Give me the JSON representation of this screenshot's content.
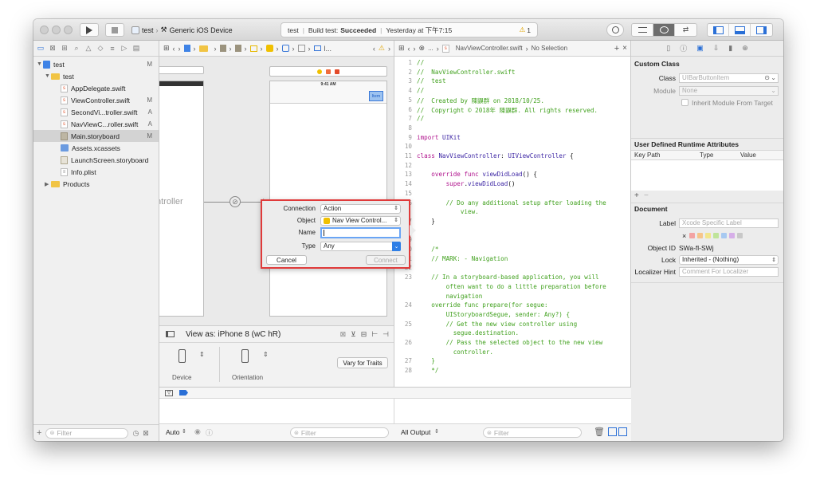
{
  "toolbar": {
    "scheme_target": "test",
    "device": "Generic iOS Device",
    "activity_target": "test",
    "activity_build_label": "Build test:",
    "activity_status": "Succeeded",
    "activity_time": "Yesterday at 下午7:15",
    "warning_count": "1"
  },
  "navigator": {
    "items": [
      {
        "label": "test",
        "status": "M",
        "kind": "project"
      },
      {
        "label": "test",
        "status": "",
        "kind": "folder"
      },
      {
        "label": "AppDelegate.swift",
        "status": "",
        "kind": "file"
      },
      {
        "label": "ViewController.swift",
        "status": "M",
        "kind": "file"
      },
      {
        "label": "SecondVi...troller.swift",
        "status": "A",
        "kind": "file"
      },
      {
        "label": "NavViewC...roller.swift",
        "status": "A",
        "kind": "file"
      },
      {
        "label": "Main.storyboard",
        "status": "M",
        "kind": "storyboard"
      },
      {
        "label": "Assets.xcassets",
        "status": "",
        "kind": "assets"
      },
      {
        "label": "LaunchScreen.storyboard",
        "status": "",
        "kind": "storyboard"
      },
      {
        "label": "Info.plist",
        "status": "",
        "kind": "file"
      },
      {
        "label": "Products",
        "status": "",
        "kind": "folder"
      }
    ],
    "filter_placeholder": "Filter"
  },
  "ib": {
    "jump_truncated": "l...",
    "controller_text": "ntroller",
    "status_time": "9:41 AM",
    "nav_item": "Item",
    "view_as": "View as: iPhone 8 (wC hR)",
    "device_label": "Device",
    "orientation_label": "Orientation",
    "vary_button": "Vary for Traits"
  },
  "code_editor": {
    "jump_bar": "NavViewController.swift",
    "jump_selection": "No Selection",
    "lines": [
      {
        "n": "1",
        "t": "//",
        "c": "com"
      },
      {
        "n": "2",
        "t": "//  NavViewController.swift",
        "c": "com"
      },
      {
        "n": "3",
        "t": "//  test",
        "c": "com"
      },
      {
        "n": "4",
        "t": "//",
        "c": "com"
      },
      {
        "n": "5",
        "t": "//  Created by 陳鼳群 on 2018/10/25.",
        "c": "com"
      },
      {
        "n": "6",
        "t": "//  Copyright © 2018年 陳鼳群. All rights reserved.",
        "c": "com"
      },
      {
        "n": "7",
        "t": "//",
        "c": "com"
      },
      {
        "n": "8",
        "t": "",
        "c": "plain"
      },
      {
        "n": "9",
        "t": "import UIKit",
        "c": "kw"
      },
      {
        "n": "10",
        "t": "",
        "c": "plain"
      },
      {
        "n": "11",
        "t": "class NavViewController: UIViewController {",
        "c": "kw"
      },
      {
        "n": "12",
        "t": "",
        "c": "plain"
      },
      {
        "n": "13",
        "t": "    override func viewDidLoad() {",
        "c": "kw"
      },
      {
        "n": "14",
        "t": "        super.viewDidLoad()",
        "c": "kw"
      },
      {
        "n": "15",
        "t": "",
        "c": "plain"
      },
      {
        "n": "16",
        "t": "        // Do any additional setup after loading the",
        "c": "com"
      },
      {
        "n": "",
        "t": "            view.",
        "c": "com"
      },
      {
        "n": "17",
        "t": "    }",
        "c": "plain"
      },
      {
        "n": "18",
        "t": "",
        "c": "plain"
      },
      {
        "n": "19",
        "t": "",
        "c": "plain"
      },
      {
        "n": "20",
        "t": "    /*",
        "c": "com"
      },
      {
        "n": "21",
        "t": "    // MARK: - Navigation",
        "c": "com"
      },
      {
        "n": "22",
        "t": "",
        "c": "plain"
      },
      {
        "n": "23",
        "t": "    // In a storyboard-based application, you will",
        "c": "com"
      },
      {
        "n": "",
        "t": "        often want to do a little preparation before",
        "c": "com"
      },
      {
        "n": "",
        "t": "        navigation",
        "c": "com"
      },
      {
        "n": "24",
        "t": "    override func prepare(for segue:",
        "c": "com"
      },
      {
        "n": "",
        "t": "        UIStoryboardSegue, sender: Any?) {",
        "c": "com"
      },
      {
        "n": "25",
        "t": "        // Get the new view controller using",
        "c": "com"
      },
      {
        "n": "",
        "t": "          segue.destination.",
        "c": "com"
      },
      {
        "n": "26",
        "t": "        // Pass the selected object to the new view",
        "c": "com"
      },
      {
        "n": "",
        "t": "          controller.",
        "c": "com"
      },
      {
        "n": "27",
        "t": "    }",
        "c": "com"
      },
      {
        "n": "28",
        "t": "    */",
        "c": "com"
      }
    ]
  },
  "connection_dialog": {
    "connection_label": "Connection",
    "connection_value": "Action",
    "object_label": "Object",
    "object_value": "Nav View Control...",
    "name_label": "Name",
    "name_value": "",
    "type_label": "Type",
    "type_value": "Any",
    "cancel": "Cancel",
    "connect": "Connect"
  },
  "debug": {
    "auto_label": "Auto",
    "filter_placeholder": "Filter",
    "output_label": "All Output",
    "output_filter_placeholder": "Filter"
  },
  "inspector": {
    "custom_class_header": "Custom Class",
    "class_label": "Class",
    "class_placeholder": "UIBarButtonItem",
    "module_label": "Module",
    "module_placeholder": "None",
    "inherit_label": "Inherit Module From Target",
    "udra_header": "User Defined Runtime Attributes",
    "col_keypath": "Key Path",
    "col_type": "Type",
    "col_value": "Value",
    "document_header": "Document",
    "label_label": "Label",
    "label_placeholder": "Xcode Specific Label",
    "objectid_label": "Object ID",
    "objectid_value": "SWa-fl-SWj",
    "lock_label": "Lock",
    "lock_value": "Inherited - (Nothing)",
    "localizer_label": "Localizer Hint",
    "localizer_placeholder": "Comment For Localizer",
    "label_colors": [
      "#f3a3a3",
      "#f6c58a",
      "#f2e58b",
      "#bfe49a",
      "#a7c9f1",
      "#d6aee8",
      "#c8c8c8"
    ]
  }
}
